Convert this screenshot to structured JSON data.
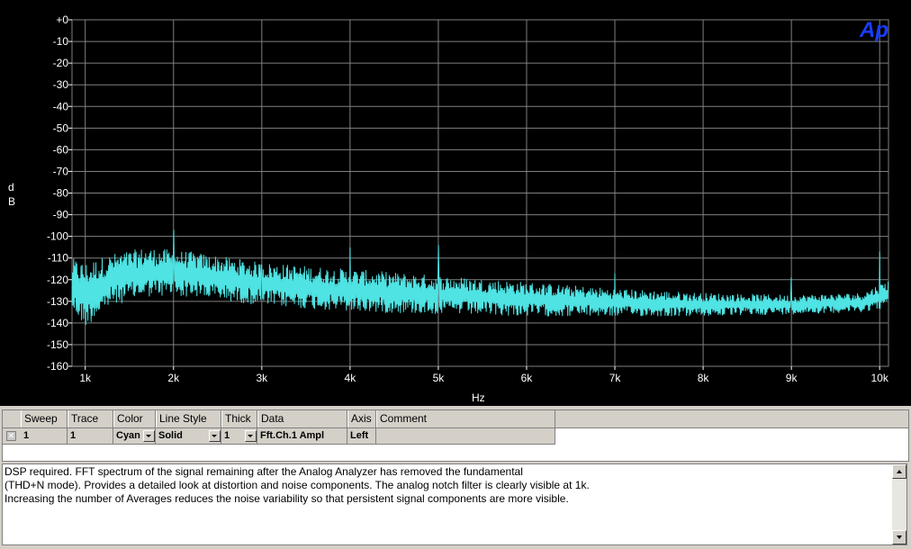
{
  "graph": {
    "logo_text": "Ap",
    "background": "#000000",
    "grid_color": "#808080",
    "trace_color": "#4fe3e3"
  },
  "chart_data": {
    "type": "line",
    "title": "",
    "xlabel": "Hz",
    "ylabel": "dB",
    "ylabel_chars": [
      "d",
      "B"
    ],
    "xlim": [
      850,
      10100
    ],
    "ylim": [
      -160,
      0
    ],
    "x_tick_labels": [
      "1k",
      "2k",
      "3k",
      "4k",
      "5k",
      "6k",
      "7k",
      "8k",
      "9k",
      "10k"
    ],
    "x_tick_values": [
      1000,
      2000,
      3000,
      4000,
      5000,
      6000,
      7000,
      8000,
      9000,
      10000
    ],
    "y_tick_labels": [
      "+0",
      "-10",
      "-20",
      "-30",
      "-40",
      "-50",
      "-60",
      "-70",
      "-80",
      "-90",
      "-100",
      "-110",
      "-120",
      "-130",
      "-140",
      "-150",
      "-160"
    ],
    "y_tick_values": [
      0,
      -10,
      -20,
      -30,
      -40,
      -50,
      -60,
      -70,
      -80,
      -90,
      -100,
      -110,
      -120,
      -130,
      -140,
      -150,
      -160
    ],
    "grid": true,
    "series": [
      {
        "name": "Fft.Ch.1 Ampl",
        "color": "Cyan",
        "noise_envelope": [
          {
            "x": 850,
            "lo": -135,
            "hi": -110
          },
          {
            "x": 1000,
            "lo": -142,
            "hi": -112
          },
          {
            "x": 1300,
            "lo": -132,
            "hi": -108
          },
          {
            "x": 1700,
            "lo": -128,
            "hi": -105
          },
          {
            "x": 2200,
            "lo": -128,
            "hi": -107
          },
          {
            "x": 3000,
            "lo": -132,
            "hi": -112
          },
          {
            "x": 4000,
            "lo": -135,
            "hi": -115
          },
          {
            "x": 5000,
            "lo": -136,
            "hi": -118
          },
          {
            "x": 6000,
            "lo": -137,
            "hi": -121
          },
          {
            "x": 7000,
            "lo": -137,
            "hi": -124
          },
          {
            "x": 8000,
            "lo": -137,
            "hi": -126
          },
          {
            "x": 9000,
            "lo": -136,
            "hi": -127
          },
          {
            "x": 9800,
            "lo": -135,
            "hi": -126
          },
          {
            "x": 10100,
            "lo": -133,
            "hi": -120
          }
        ],
        "peaks": [
          {
            "x": 2000,
            "y": -97
          },
          {
            "x": 3000,
            "y": -113
          },
          {
            "x": 4000,
            "y": -105
          },
          {
            "x": 5000,
            "y": -104
          },
          {
            "x": 7000,
            "y": -117
          },
          {
            "x": 9000,
            "y": -119
          },
          {
            "x": 10000,
            "y": -107
          }
        ]
      }
    ]
  },
  "sweep_table": {
    "headers": [
      "Sweep",
      "Trace",
      "Color",
      "Line Style",
      "Thick",
      "Data",
      "Axis",
      "Comment"
    ],
    "row": {
      "checked_glyph": "✕",
      "sweep": "1",
      "trace": "1",
      "color": "Cyan",
      "line_style": "Solid",
      "thick": "1",
      "data": "Fft.Ch.1 Ampl",
      "axis": "Left",
      "comment": ""
    }
  },
  "comment": {
    "text": "DSP required.  FFT spectrum of the signal remaining after the Analog  Analyzer has removed the fundamental\n(THD+N mode).  Provides a detailed look at distortion and noise components.  The analog notch filter is clearly visible at 1k.\nIncreasing the number of Averages reduces the noise variability so that persistent signal components are more visible."
  }
}
